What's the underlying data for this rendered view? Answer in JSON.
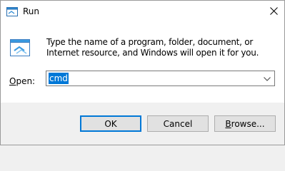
{
  "window": {
    "title": "Run",
    "icon": "run-icon",
    "close_icon": "close-icon"
  },
  "dialog": {
    "icon": "run-program-icon",
    "description": "Type the name of a program, folder, document, or Internet resource, and Windows will open it for you.",
    "open_label_mnemonic": "O",
    "open_label_rest": "pen:",
    "open_value": "cmd"
  },
  "buttons": {
    "ok": "OK",
    "cancel": "Cancel",
    "browse_mnemonic": "B",
    "browse_rest": "rowse..."
  },
  "colors": {
    "selection": "#0078d7",
    "footer_bg": "#f0f0f0",
    "button_bg": "#e1e1e1"
  }
}
